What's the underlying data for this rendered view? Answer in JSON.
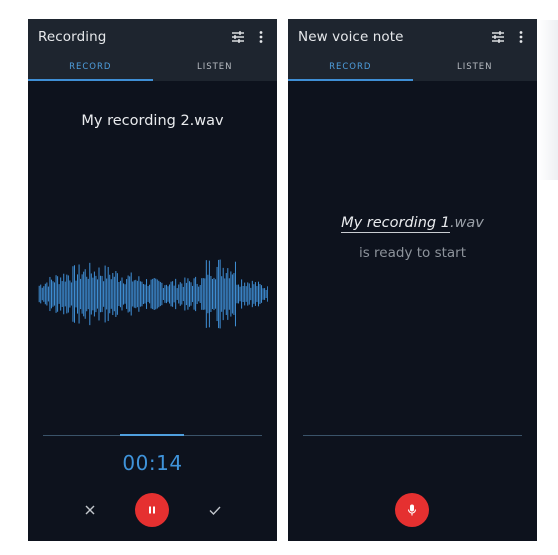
{
  "left_screen": {
    "title": "Recording",
    "tabs": [
      {
        "label": "RECORD",
        "active": true
      },
      {
        "label": "LISTEN",
        "active": false
      }
    ],
    "filename": "My recording 2.wav",
    "timer": "00:14",
    "controls": {
      "discard_icon": "close-icon",
      "main_icon": "pause-icon",
      "accept_icon": "check-icon"
    }
  },
  "right_screen": {
    "title": "New voice note",
    "tabs": [
      {
        "label": "RECORD",
        "active": true
      },
      {
        "label": "LISTEN",
        "active": false
      }
    ],
    "filename_base": "My recording 1",
    "filename_ext": ".wav",
    "status": "is ready to start",
    "controls": {
      "main_icon": "microphone-icon"
    }
  },
  "colors": {
    "background": "#0d121d",
    "appbar": "#1e252f",
    "accent": "#4f9fde",
    "record_button": "#e53030"
  }
}
